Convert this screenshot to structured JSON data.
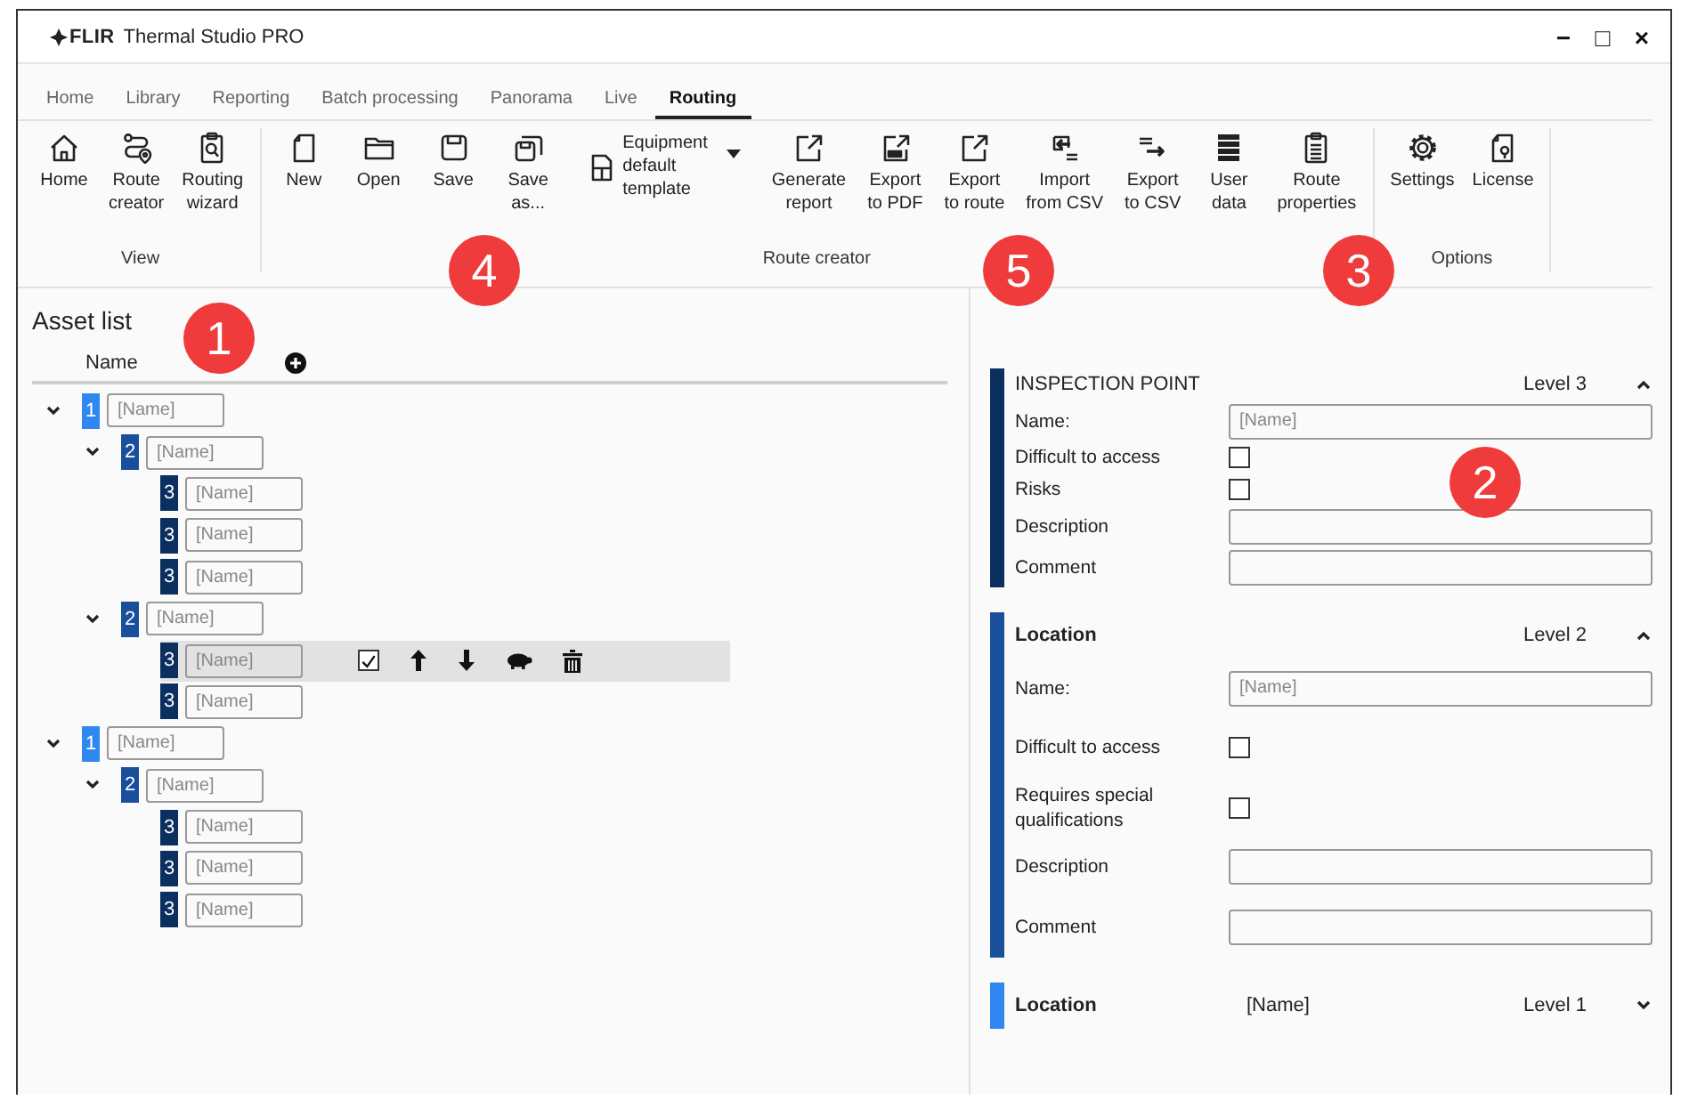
{
  "window": {
    "logo": "FLIR",
    "title": "Thermal Studio PRO",
    "controls": [
      "−",
      "□",
      "×"
    ]
  },
  "tabs": [
    {
      "label": "Home",
      "selected": false
    },
    {
      "label": "Library",
      "selected": false
    },
    {
      "label": "Reporting",
      "selected": false
    },
    {
      "label": "Batch processing",
      "selected": false
    },
    {
      "label": "Panorama",
      "selected": false
    },
    {
      "label": "Live",
      "selected": false
    },
    {
      "label": "Routing",
      "selected": true
    }
  ],
  "ribbon": [
    {
      "label": "View",
      "items": [
        {
          "kind": "button",
          "label": "Home"
        },
        {
          "kind": "button",
          "label": "Route\ncreator"
        },
        {
          "kind": "button",
          "label": "Routing\nwizard"
        }
      ]
    },
    {
      "label": "Route creator",
      "items": [
        {
          "kind": "button",
          "label": "New"
        },
        {
          "kind": "button",
          "label": "Open"
        },
        {
          "kind": "button",
          "label": "Save"
        },
        {
          "kind": "button",
          "label": "Save\nas..."
        },
        {
          "kind": "dropdown",
          "label": "Equipment\ndefault\ntemplate"
        },
        {
          "kind": "button",
          "label": "Generate\nreport"
        },
        {
          "kind": "button",
          "label": "Export\nto PDF"
        },
        {
          "kind": "button",
          "label": "Export\nto route"
        },
        {
          "kind": "button",
          "label": "Import\nfrom CSV"
        },
        {
          "kind": "button",
          "label": "Export\nto CSV"
        },
        {
          "kind": "button",
          "label": "User\ndata"
        },
        {
          "kind": "button",
          "label": "Route\nproperties"
        }
      ]
    },
    {
      "label": "Options",
      "items": [
        {
          "kind": "button",
          "label": "Settings"
        },
        {
          "kind": "button",
          "label": "License"
        }
      ]
    }
  ],
  "asset_list": {
    "title": "Asset list",
    "column": "Name",
    "row_tools": {
      "checked": true
    },
    "items": [
      {
        "level": "1",
        "placeholder": "[Name]",
        "expanded": true,
        "selected": false,
        "children": [
          {
            "level": "2",
            "placeholder": "[Name]",
            "expanded": true,
            "selected": false,
            "children": [
              {
                "level": "3",
                "placeholder": "[Name]",
                "selected": false
              },
              {
                "level": "3",
                "placeholder": "[Name]",
                "selected": false
              },
              {
                "level": "3",
                "placeholder": "[Name]",
                "selected": false
              }
            ]
          },
          {
            "level": "2",
            "placeholder": "[Name]",
            "expanded": true,
            "selected": false,
            "children": [
              {
                "level": "3",
                "placeholder": "[Name]",
                "selected": true
              },
              {
                "level": "3",
                "placeholder": "[Name]",
                "selected": false
              }
            ]
          }
        ]
      },
      {
        "level": "1",
        "placeholder": "[Name]",
        "expanded": true,
        "selected": false,
        "children": [
          {
            "level": "2",
            "placeholder": "[Name]",
            "expanded": true,
            "selected": false,
            "children": [
              {
                "level": "3",
                "placeholder": "[Name]",
                "selected": false
              },
              {
                "level": "3",
                "placeholder": "[Name]",
                "selected": false
              },
              {
                "level": "3",
                "placeholder": "[Name]",
                "selected": false
              }
            ]
          }
        ]
      }
    ]
  },
  "properties": [
    {
      "kind": "point",
      "color": "#0b2f5e",
      "title": "INSPECTION POINT",
      "level": "Level 3",
      "expanded": true,
      "fields": [
        {
          "kind": "text",
          "label": "Name:",
          "placeholder": "[Name]"
        },
        {
          "kind": "checkbox",
          "label": "Difficult to access",
          "checked": false
        },
        {
          "kind": "checkbox",
          "label": "Risks",
          "checked": false
        },
        {
          "kind": "text",
          "label": "Description"
        },
        {
          "kind": "text",
          "label": "Comment"
        }
      ]
    },
    {
      "kind": "location",
      "color": "#1a4f9c",
      "title": "Location",
      "level": "Level 2",
      "expanded": true,
      "fields": [
        {
          "kind": "text",
          "label": "Name:",
          "placeholder": "[Name]"
        },
        {
          "kind": "checkbox",
          "label": "Difficult to access",
          "checked": false
        },
        {
          "kind": "checkbox",
          "label": "Requires special\nqualifications",
          "checked": false
        },
        {
          "kind": "text",
          "label": "Description"
        },
        {
          "kind": "text",
          "label": "Comment"
        }
      ]
    },
    {
      "kind": "location",
      "color": "#2f88f2",
      "title": "Location",
      "value": "[Name]",
      "level": "Level 1",
      "expanded": false
    }
  ],
  "callouts": [
    "4",
    "5",
    "3",
    "1",
    "2"
  ]
}
